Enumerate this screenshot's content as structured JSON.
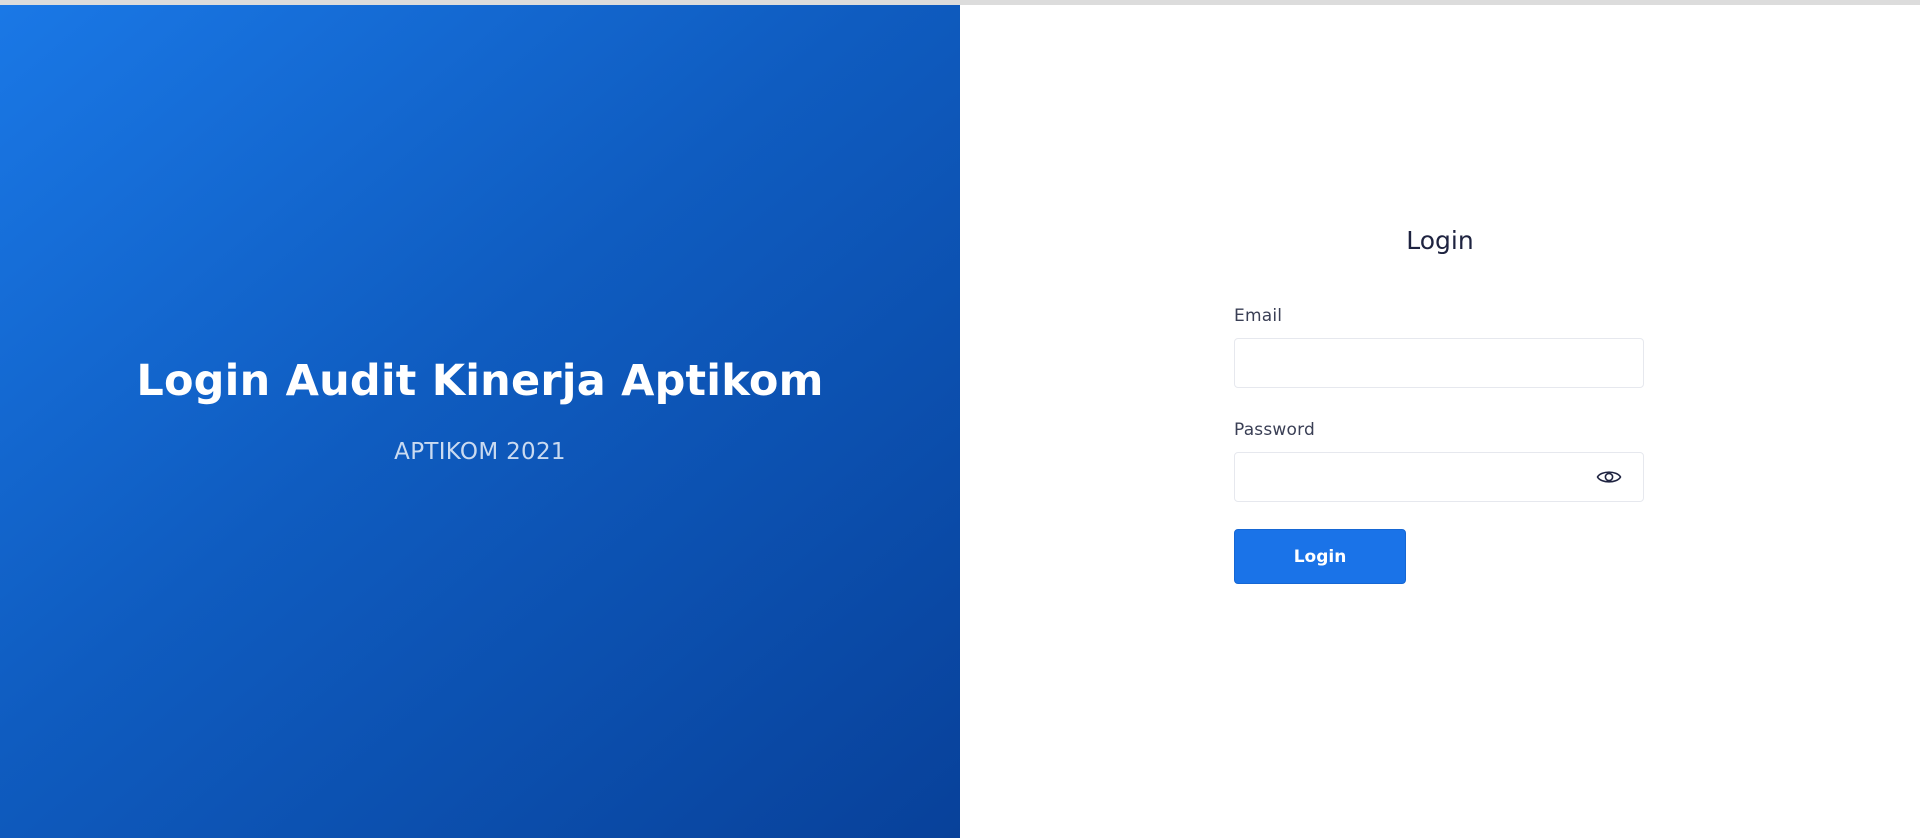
{
  "hero": {
    "title": "Login Audit Kinerja Aptikom",
    "subtitle": "APTIKOM 2021",
    "gradient_colors": [
      "#1a78e6",
      "#08419a"
    ]
  },
  "form": {
    "title": "Login",
    "email": {
      "label": "Email",
      "value": "",
      "placeholder": ""
    },
    "password": {
      "label": "Password",
      "value": "",
      "placeholder": "",
      "toggle_icon": "eye-icon"
    },
    "submit_label": "Login",
    "accent_color": "#1a73e8"
  }
}
